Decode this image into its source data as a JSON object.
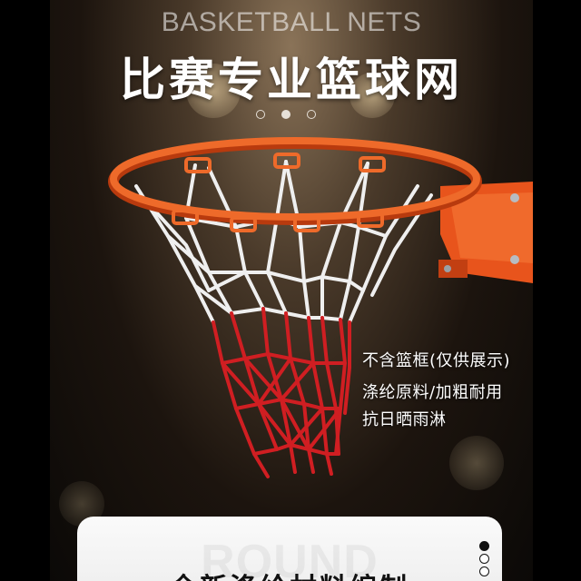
{
  "header": {
    "eyebrow": "BASKETBALL NETS",
    "title": "比赛专业篮球网"
  },
  "carousel": {
    "total": 3,
    "active_index": 1
  },
  "features": [
    "不含篮框(仅供展示)",
    "涤纶原料/加粗耐用",
    "抗日晒雨淋"
  ],
  "bottom_card": {
    "watermark": "ROUND",
    "text": "全新涤纶材料编制"
  },
  "side_pager": {
    "total": 3,
    "active_index": 0
  },
  "colors": {
    "rim": "#e8541c",
    "net_white": "#efefef",
    "net_red": "#d01e22",
    "background": "#1c140e"
  },
  "icons": {
    "carousel_dot": "circle",
    "pager_dot": "circle"
  }
}
